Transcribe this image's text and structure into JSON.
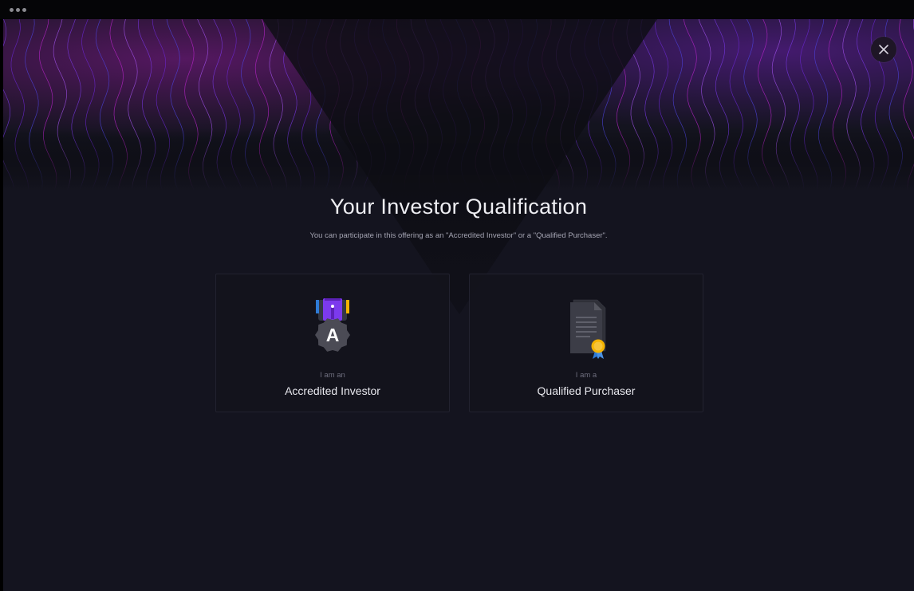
{
  "page": {
    "title": "Your Investor Qualification",
    "subtitle": "You can participate in this offering as an \"Accredited Investor\" or a \"Qualified Purchaser\"."
  },
  "options": [
    {
      "prefix": "I am an",
      "label": "Accredited Investor",
      "badge_letter": "A",
      "icon": "accredited-medal-icon"
    },
    {
      "prefix": "I am a",
      "label": "Qualified Purchaser",
      "icon": "certificate-document-icon"
    }
  ],
  "controls": {
    "close_icon": "close-icon"
  },
  "colors": {
    "background": "#14141f",
    "card_background": "#13131c",
    "card_border": "#22222f",
    "accent_purple": "#7c3aed",
    "accent_magenta": "#c026d3",
    "accent_gold": "#f5b400",
    "accent_blue": "#2e7bd6",
    "title_text": "#eeeef3"
  }
}
